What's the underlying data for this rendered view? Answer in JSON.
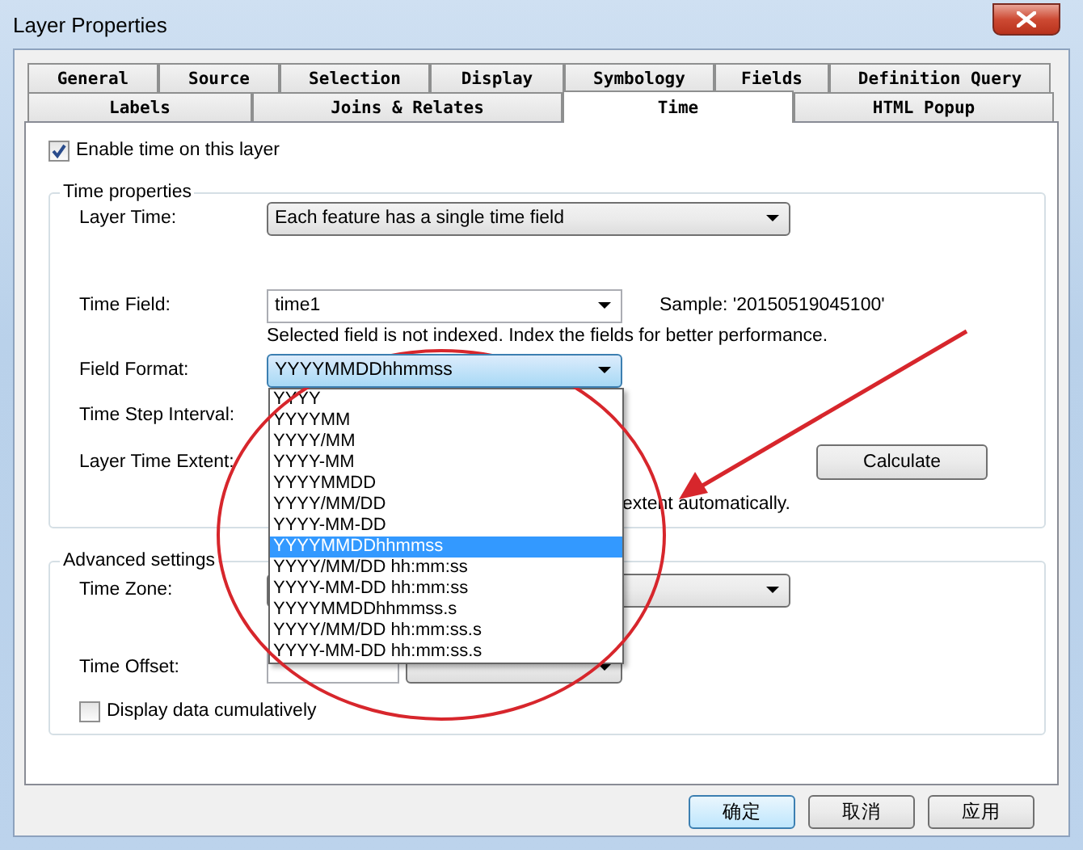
{
  "window": {
    "title": "Layer Properties"
  },
  "tab_rows": [
    {
      "tabs": [
        {
          "label": "General",
          "selected": false
        },
        {
          "label": "Source",
          "selected": false
        },
        {
          "label": "Selection",
          "selected": false
        },
        {
          "label": "Display",
          "selected": false
        },
        {
          "label": "Symbology",
          "selected": false
        },
        {
          "label": "Fields",
          "selected": false
        },
        {
          "label": "Definition Query",
          "selected": false
        }
      ]
    },
    {
      "tabs": [
        {
          "label": "Labels",
          "selected": false
        },
        {
          "label": "Joins & Relates",
          "selected": false
        },
        {
          "label": "Time",
          "selected": true
        },
        {
          "label": "HTML Popup",
          "selected": false
        }
      ]
    }
  ],
  "enable_time": {
    "label": "Enable time on this layer",
    "checked": true
  },
  "time_properties": {
    "title": "Time properties",
    "layer_time": {
      "label": "Layer Time:",
      "value": "Each feature has a single time field"
    },
    "time_field": {
      "label": "Time Field:",
      "value": "time1",
      "sample": "Sample: '20150519045100'"
    },
    "note": "Selected field is not indexed. Index the fields for better performance.",
    "field_format": {
      "label": "Field Format:",
      "value": "YYYYMMDDhhmmss",
      "expanded": true,
      "options": [
        {
          "label": "YYYY",
          "selected": false
        },
        {
          "label": "YYYYMM",
          "selected": false
        },
        {
          "label": "YYYY/MM",
          "selected": false
        },
        {
          "label": "YYYY-MM",
          "selected": false
        },
        {
          "label": "YYYYMMDD",
          "selected": false
        },
        {
          "label": "YYYY/MM/DD",
          "selected": false
        },
        {
          "label": "YYYY-MM-DD",
          "selected": false
        },
        {
          "label": "YYYYMMDDhhmmss",
          "selected": true
        },
        {
          "label": "YYYY/MM/DD hh:mm:ss",
          "selected": false
        },
        {
          "label": "YYYY-MM-DD hh:mm:ss",
          "selected": false
        },
        {
          "label": "YYYYMMDDhhmmss.s",
          "selected": false
        },
        {
          "label": "YYYY/MM/DD hh:mm:ss.s",
          "selected": false
        },
        {
          "label": "YYYY-MM-DD hh:mm:ss.s",
          "selected": false
        }
      ]
    },
    "time_step_interval": {
      "label": "Time Step Interval:"
    },
    "layer_time_extent": {
      "label": "Layer Time Extent:"
    },
    "calculate_button": "Calculate",
    "extent_note": "extent automatically."
  },
  "advanced_settings": {
    "title": "Advanced settings",
    "time_zone": {
      "label": "Time Zone:"
    },
    "time_offset": {
      "label": "Time Offset:"
    },
    "display_cumulatively": {
      "label": "Display data cumulatively",
      "checked": false
    }
  },
  "buttons": [
    {
      "label": "确定",
      "kind": "default"
    },
    {
      "label": "取消",
      "kind": "normal"
    },
    {
      "label": "应用",
      "kind": "normal"
    }
  ]
}
